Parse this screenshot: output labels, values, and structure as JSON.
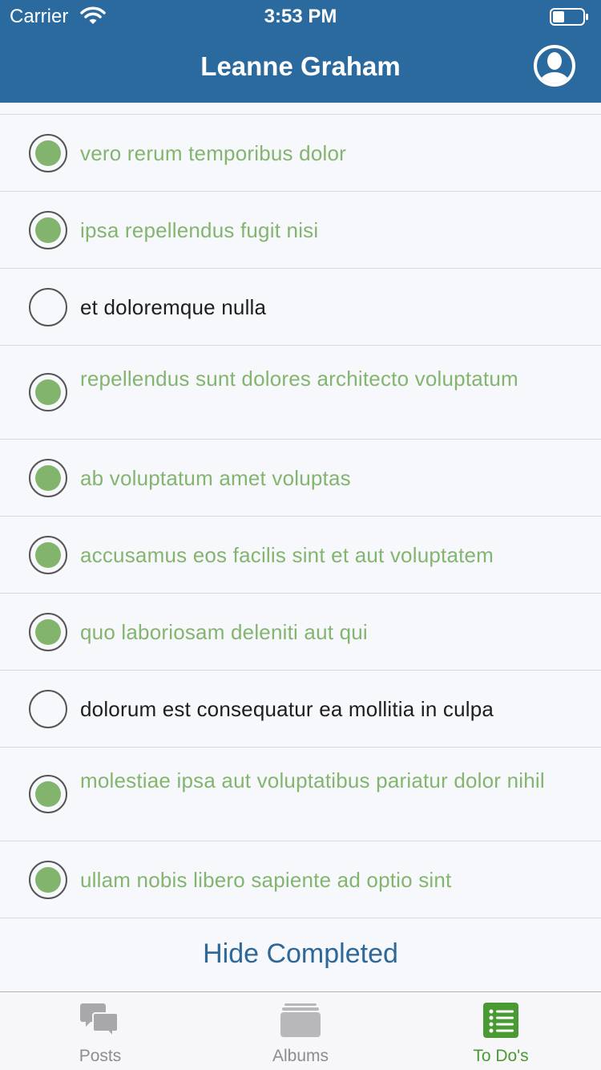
{
  "status_bar": {
    "carrier": "Carrier",
    "time": "3:53 PM"
  },
  "nav": {
    "title": "Leanne Graham",
    "profile_icon": "person-circle-icon"
  },
  "todos": [
    {
      "text": "vero rerum temporibus dolor",
      "completed": true
    },
    {
      "text": "ipsa repellendus fugit nisi",
      "completed": true
    },
    {
      "text": "et doloremque nulla",
      "completed": false
    },
    {
      "text": "repellendus sunt dolores architecto voluptatum",
      "completed": true
    },
    {
      "text": "ab voluptatum amet voluptas",
      "completed": true
    },
    {
      "text": "accusamus eos facilis sint et aut voluptatem",
      "completed": true
    },
    {
      "text": "quo laboriosam deleniti aut qui",
      "completed": true
    },
    {
      "text": "dolorum est consequatur ea mollitia in culpa",
      "completed": false
    },
    {
      "text": "molestiae ipsa aut voluptatibus pariatur dolor nihil",
      "completed": true
    },
    {
      "text": "ullam nobis libero sapiente ad optio sint",
      "completed": true
    }
  ],
  "hide_completed_label": "Hide Completed",
  "tabs": [
    {
      "label": "Posts",
      "icon": "chat-bubbles-icon",
      "active": false
    },
    {
      "label": "Albums",
      "icon": "albums-stack-icon",
      "active": false
    },
    {
      "label": "To Do's",
      "icon": "checklist-icon",
      "active": true
    }
  ],
  "colors": {
    "header": "#2a6a9e",
    "completed_text": "#83b56f",
    "check_fill": "#82b46e",
    "link": "#2d6899",
    "tab_active": "#4a9a33",
    "tab_inactive": "#8d8d90"
  }
}
